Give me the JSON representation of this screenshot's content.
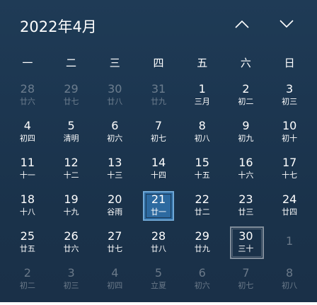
{
  "header": {
    "title": "2022年4月",
    "prev_icon": "chevron-up-icon",
    "next_icon": "chevron-down-icon"
  },
  "weekdays": [
    "一",
    "二",
    "三",
    "四",
    "五",
    "六",
    "日"
  ],
  "weeks": [
    [
      {
        "day": "28",
        "lunar": "廿六",
        "other": true
      },
      {
        "day": "29",
        "lunar": "廿七",
        "other": true
      },
      {
        "day": "30",
        "lunar": "廿八",
        "other": true
      },
      {
        "day": "31",
        "lunar": "廿九",
        "other": true
      },
      {
        "day": "1",
        "lunar": "三月",
        "other": false
      },
      {
        "day": "2",
        "lunar": "初二",
        "other": false
      },
      {
        "day": "3",
        "lunar": "初三",
        "other": false
      }
    ],
    [
      {
        "day": "4",
        "lunar": "初四",
        "other": false
      },
      {
        "day": "5",
        "lunar": "清明",
        "other": false
      },
      {
        "day": "6",
        "lunar": "初六",
        "other": false
      },
      {
        "day": "7",
        "lunar": "初七",
        "other": false
      },
      {
        "day": "8",
        "lunar": "初八",
        "other": false
      },
      {
        "day": "9",
        "lunar": "初九",
        "other": false
      },
      {
        "day": "10",
        "lunar": "初十",
        "other": false
      }
    ],
    [
      {
        "day": "11",
        "lunar": "十一",
        "other": false
      },
      {
        "day": "12",
        "lunar": "十二",
        "other": false
      },
      {
        "day": "13",
        "lunar": "十三",
        "other": false
      },
      {
        "day": "14",
        "lunar": "十四",
        "other": false
      },
      {
        "day": "15",
        "lunar": "十五",
        "other": false
      },
      {
        "day": "16",
        "lunar": "十六",
        "other": false
      },
      {
        "day": "17",
        "lunar": "十七",
        "other": false
      }
    ],
    [
      {
        "day": "18",
        "lunar": "十八",
        "other": false
      },
      {
        "day": "19",
        "lunar": "十九",
        "other": false
      },
      {
        "day": "20",
        "lunar": "谷雨",
        "other": false
      },
      {
        "day": "21",
        "lunar": "廿一",
        "other": false,
        "today": true
      },
      {
        "day": "22",
        "lunar": "廿二",
        "other": false
      },
      {
        "day": "23",
        "lunar": "廿三",
        "other": false
      },
      {
        "day": "24",
        "lunar": "廿四",
        "other": false
      }
    ],
    [
      {
        "day": "25",
        "lunar": "廿五",
        "other": false
      },
      {
        "day": "26",
        "lunar": "廿六",
        "other": false
      },
      {
        "day": "27",
        "lunar": "廿七",
        "other": false
      },
      {
        "day": "28",
        "lunar": "廿八",
        "other": false
      },
      {
        "day": "29",
        "lunar": "廿九",
        "other": false
      },
      {
        "day": "30",
        "lunar": "三十",
        "other": false,
        "hover": true
      },
      {
        "day": "1",
        "lunar": "",
        "other": true
      }
    ],
    [
      {
        "day": "2",
        "lunar": "初二",
        "other": true
      },
      {
        "day": "3",
        "lunar": "初三",
        "other": true
      },
      {
        "day": "4",
        "lunar": "初四",
        "other": true
      },
      {
        "day": "5",
        "lunar": "立夏",
        "other": true
      },
      {
        "day": "6",
        "lunar": "初六",
        "other": true
      },
      {
        "day": "7",
        "lunar": "初七",
        "other": true
      },
      {
        "day": "8",
        "lunar": "初八",
        "other": true
      }
    ]
  ],
  "colors": {
    "today_fill": "#2d6aa0",
    "today_border": "#6fa8d6",
    "background": "#1c3650"
  }
}
